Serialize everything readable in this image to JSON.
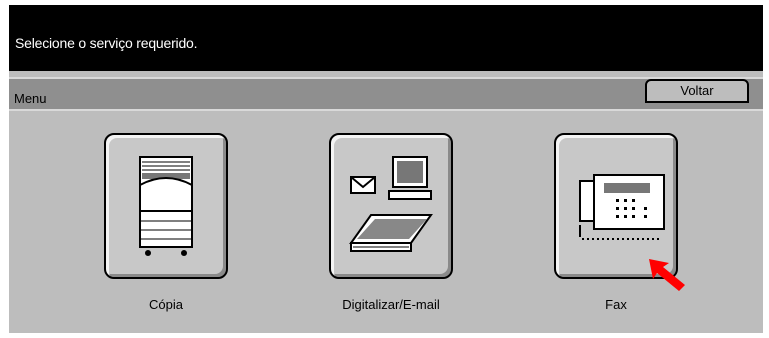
{
  "header": {
    "message": "Selecione o serviço requerido."
  },
  "menubar": {
    "label": "Menu",
    "back_button": "Voltar"
  },
  "services": [
    {
      "label": "Cópia",
      "icon": "copier-icon"
    },
    {
      "label": "Digitalizar/E-mail",
      "icon": "scan-email-icon"
    },
    {
      "label": "Fax",
      "icon": "fax-icon"
    }
  ],
  "annotation": {
    "pointer_color": "#ff0000",
    "target": "Fax"
  }
}
